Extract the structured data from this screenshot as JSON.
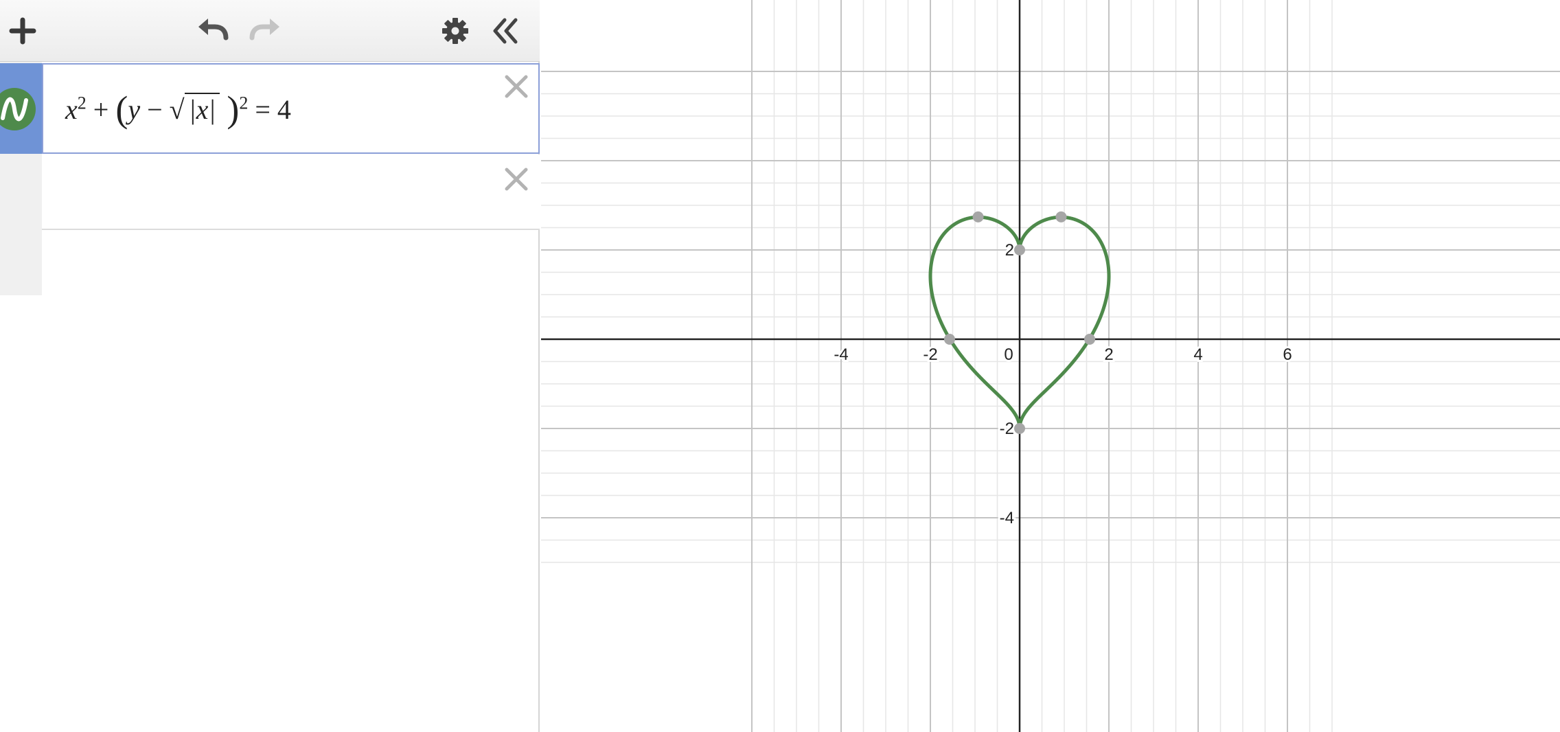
{
  "toolbar": {
    "add": "plus-icon",
    "undo": "undo-icon",
    "redo": "redo-icon",
    "settings": "gear-icon",
    "collapse": "double-chevron-left-icon"
  },
  "expressions": [
    {
      "latex": "x^2 + (y - √|x|)^2 = 4",
      "color": "#4e8a4b",
      "icon": "function-wave-icon",
      "parts": {
        "x": "x",
        "two": "2",
        "plus": "+",
        "lp": "(",
        "y": "y",
        "minus": "−",
        "sqrt": "√",
        "abs": "|x|",
        "rp": ")",
        "two2": "2",
        "eq": "=",
        "four": "4"
      }
    },
    {
      "latex": ""
    }
  ],
  "colors": {
    "curve": "#4e8a4b",
    "gridMinor": "#e6e6e6",
    "gridMajor": "#c4c4c4",
    "axis": "#222222",
    "point": "#a6a6a6",
    "activeTab": "#6f93d6"
  },
  "chart_data": {
    "type": "line",
    "title": "",
    "equation": "x^2 + (y - sqrt(|x|))^2 = 4",
    "xlim": [
      -5.6,
      6.0
    ],
    "ylim": [
      -4.3,
      4.0
    ],
    "grid": true,
    "x_ticks": [
      "-4",
      "-2",
      "0",
      "2",
      "4",
      "6"
    ],
    "y_ticks": [
      "2",
      "-2",
      "-4"
    ],
    "points": [
      {
        "x": -0.93,
        "y": 2.74
      },
      {
        "x": 0.93,
        "y": 2.74
      },
      {
        "x": 0,
        "y": 2
      },
      {
        "x": -1.57,
        "y": 0
      },
      {
        "x": 1.57,
        "y": 0
      },
      {
        "x": 0,
        "y": -2
      }
    ]
  }
}
